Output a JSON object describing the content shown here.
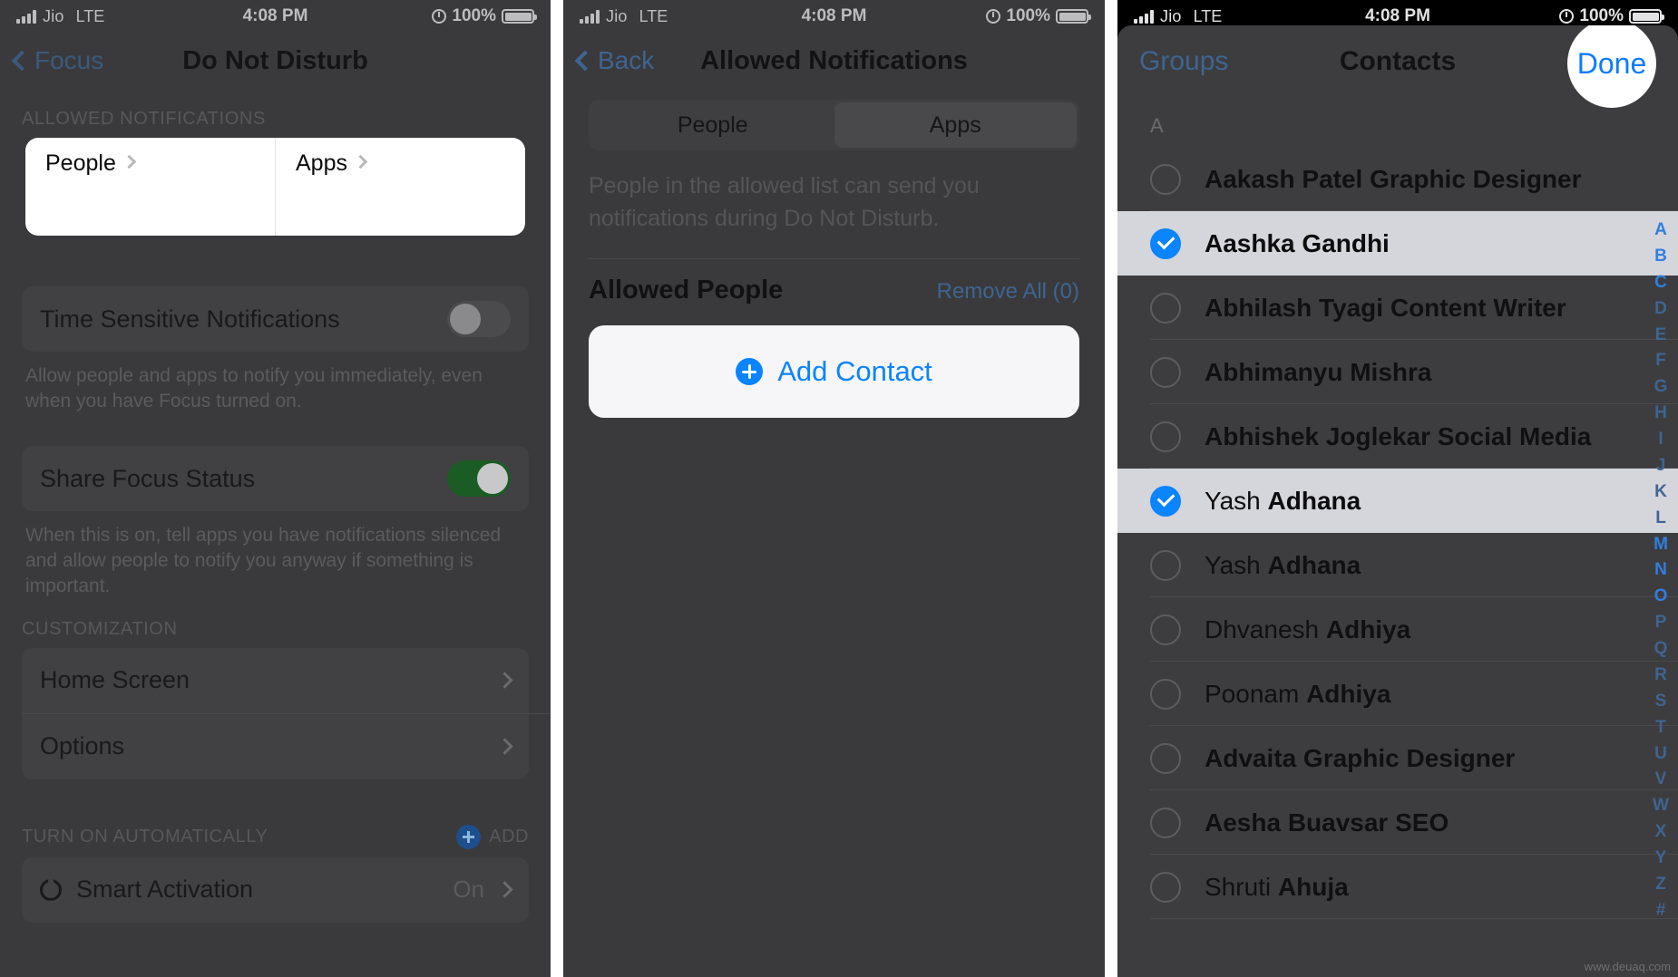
{
  "status_bar": {
    "carrier": "Jio",
    "network": "LTE",
    "time": "4:08 PM",
    "battery_percent": "100%",
    "signal_icon": "signal-bars-icon",
    "lock_icon": "rotation-lock-icon",
    "battery_icon": "battery-full-icon"
  },
  "panel1": {
    "nav": {
      "back_label": "Focus",
      "title": "Do Not Disturb",
      "back_icon": "chevron-left-icon"
    },
    "section_allowed": {
      "header": "ALLOWED NOTIFICATIONS",
      "cells": [
        {
          "label": "People",
          "chevron": "chevron-right-icon"
        },
        {
          "label": "Apps",
          "chevron": "chevron-right-icon"
        }
      ]
    },
    "time_sensitive": {
      "label": "Time Sensitive Notifications",
      "toggle_state": "off",
      "footnote": "Allow people and apps to notify you immediately, even when you have Focus turned on."
    },
    "share_focus": {
      "label": "Share Focus Status",
      "toggle_state": "on",
      "footnote": "When this is on, tell apps you have notifications silenced and allow people to notify you anyway if something is important."
    },
    "customization": {
      "header": "CUSTOMIZATION",
      "items": [
        {
          "label": "Home Screen",
          "chevron": "chevron-right-icon"
        },
        {
          "label": "Options",
          "chevron": "chevron-right-icon"
        }
      ]
    },
    "turn_on_automatically": {
      "header": "TURN ON AUTOMATICALLY",
      "add_label": "ADD",
      "add_icon": "plus-circle-icon",
      "items": [
        {
          "icon": "power-icon",
          "label": "Smart Activation",
          "value": "On",
          "chevron": "chevron-right-icon"
        }
      ]
    }
  },
  "panel2": {
    "nav": {
      "back_label": "Back",
      "title": "Allowed Notifications",
      "back_icon": "chevron-left-icon"
    },
    "segmented": {
      "options": [
        "People",
        "Apps"
      ],
      "selected": "Apps"
    },
    "note": "People in the allowed list can send you notifications during Do Not Disturb.",
    "list_header": {
      "title": "Allowed People",
      "action": "Remove All (0)"
    },
    "add_contact": {
      "label": "Add Contact",
      "icon": "plus-circle-icon"
    }
  },
  "panel3": {
    "sheet_nav": {
      "left_label": "Groups",
      "title": "Contacts",
      "right_label": "Done"
    },
    "index_letter": "A",
    "contacts": [
      {
        "first": "",
        "last": "Aakash Patel Graphic Designer",
        "selected": false,
        "bold_all": true
      },
      {
        "first": "",
        "last": "Aashka Gandhi",
        "selected": true,
        "bold_all": true
      },
      {
        "first": "",
        "last": "Abhilash Tyagi Content Writer",
        "selected": false,
        "bold_all": true
      },
      {
        "first": "",
        "last": "Abhimanyu Mishra",
        "selected": false,
        "bold_all": true
      },
      {
        "first": "",
        "last": "Abhishek Joglekar Social Media",
        "selected": false,
        "bold_all": true
      },
      {
        "first": "Yash ",
        "last": "Adhana",
        "selected": true,
        "bold_all": false
      },
      {
        "first": "Yash ",
        "last": "Adhana",
        "selected": false,
        "bold_all": false
      },
      {
        "first": "Dhvanesh ",
        "last": "Adhiya",
        "selected": false,
        "bold_all": false
      },
      {
        "first": "Poonam ",
        "last": "Adhiya",
        "selected": false,
        "bold_all": false
      },
      {
        "first": "",
        "last": "Advaita Graphic Designer",
        "selected": false,
        "bold_all": true
      },
      {
        "first": "",
        "last": "Aesha Buavsar SEO",
        "selected": false,
        "bold_all": true
      },
      {
        "first": "Shruti ",
        "last": "Ahuja",
        "selected": false,
        "bold_all": false
      }
    ],
    "alpha_index": [
      "A",
      "B",
      "C",
      "D",
      "E",
      "F",
      "G",
      "H",
      "I",
      "J",
      "K",
      "L",
      "M",
      "N",
      "O",
      "P",
      "Q",
      "R",
      "S",
      "T",
      "U",
      "V",
      "W",
      "X",
      "Y",
      "Z",
      "#"
    ],
    "alpha_highlighted": [
      "A",
      "B",
      "C",
      "M",
      "N",
      "O"
    ],
    "watermark": "www.deuaq.com"
  },
  "colors": {
    "accent_blue": "#0a84ff",
    "dim_blue": "#3f6490",
    "toggle_on_green": "#1a5c23",
    "selected_row": "#d5d5dc",
    "panel_bg": "#3a3a3c"
  }
}
